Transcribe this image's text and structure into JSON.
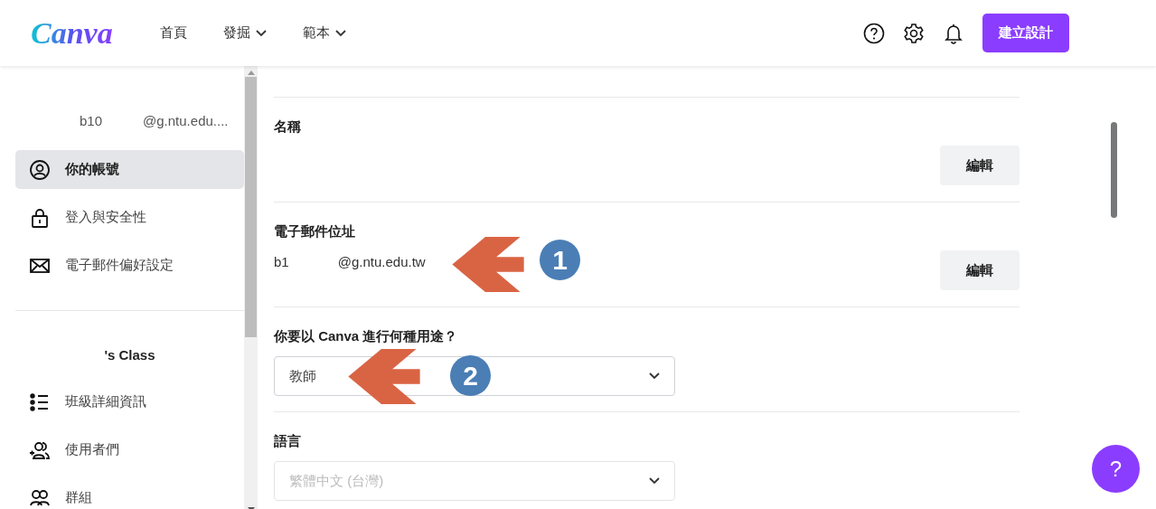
{
  "header": {
    "logo": "Canva",
    "nav": [
      {
        "label": "首頁",
        "dropdown": false
      },
      {
        "label": "發掘",
        "dropdown": true
      },
      {
        "label": "範本",
        "dropdown": true
      }
    ],
    "create_button": "建立設計"
  },
  "sidebar": {
    "user_name": "b10",
    "user_email": "@g.ntu.edu....",
    "account_items": [
      {
        "label": "你的帳號",
        "selected": true
      },
      {
        "label": "登入與安全性",
        "selected": false
      },
      {
        "label": "電子郵件偏好設定",
        "selected": false
      }
    ],
    "class_title": "'s Class",
    "class_items": [
      {
        "label": "班級詳細資訊",
        "selected": false
      },
      {
        "label": "使用者們",
        "selected": false
      },
      {
        "label": "群組",
        "selected": false
      }
    ]
  },
  "main": {
    "sections": [
      {
        "kind": "edit",
        "label": "名稱",
        "button": "編輯"
      },
      {
        "kind": "edit",
        "label": "電子郵件位址",
        "value_parts": [
          "b1",
          "@g.ntu.edu.tw"
        ],
        "button": "編輯"
      },
      {
        "kind": "select",
        "label": "你要以 Canva 進行何種用途？",
        "value": "教師",
        "faded": false
      },
      {
        "kind": "select",
        "label": "語言",
        "value": "繁體中文 (台灣)",
        "faded": true
      }
    ],
    "annotations": [
      {
        "label": "1"
      },
      {
        "label": "2"
      }
    ]
  },
  "help_button": "?"
}
